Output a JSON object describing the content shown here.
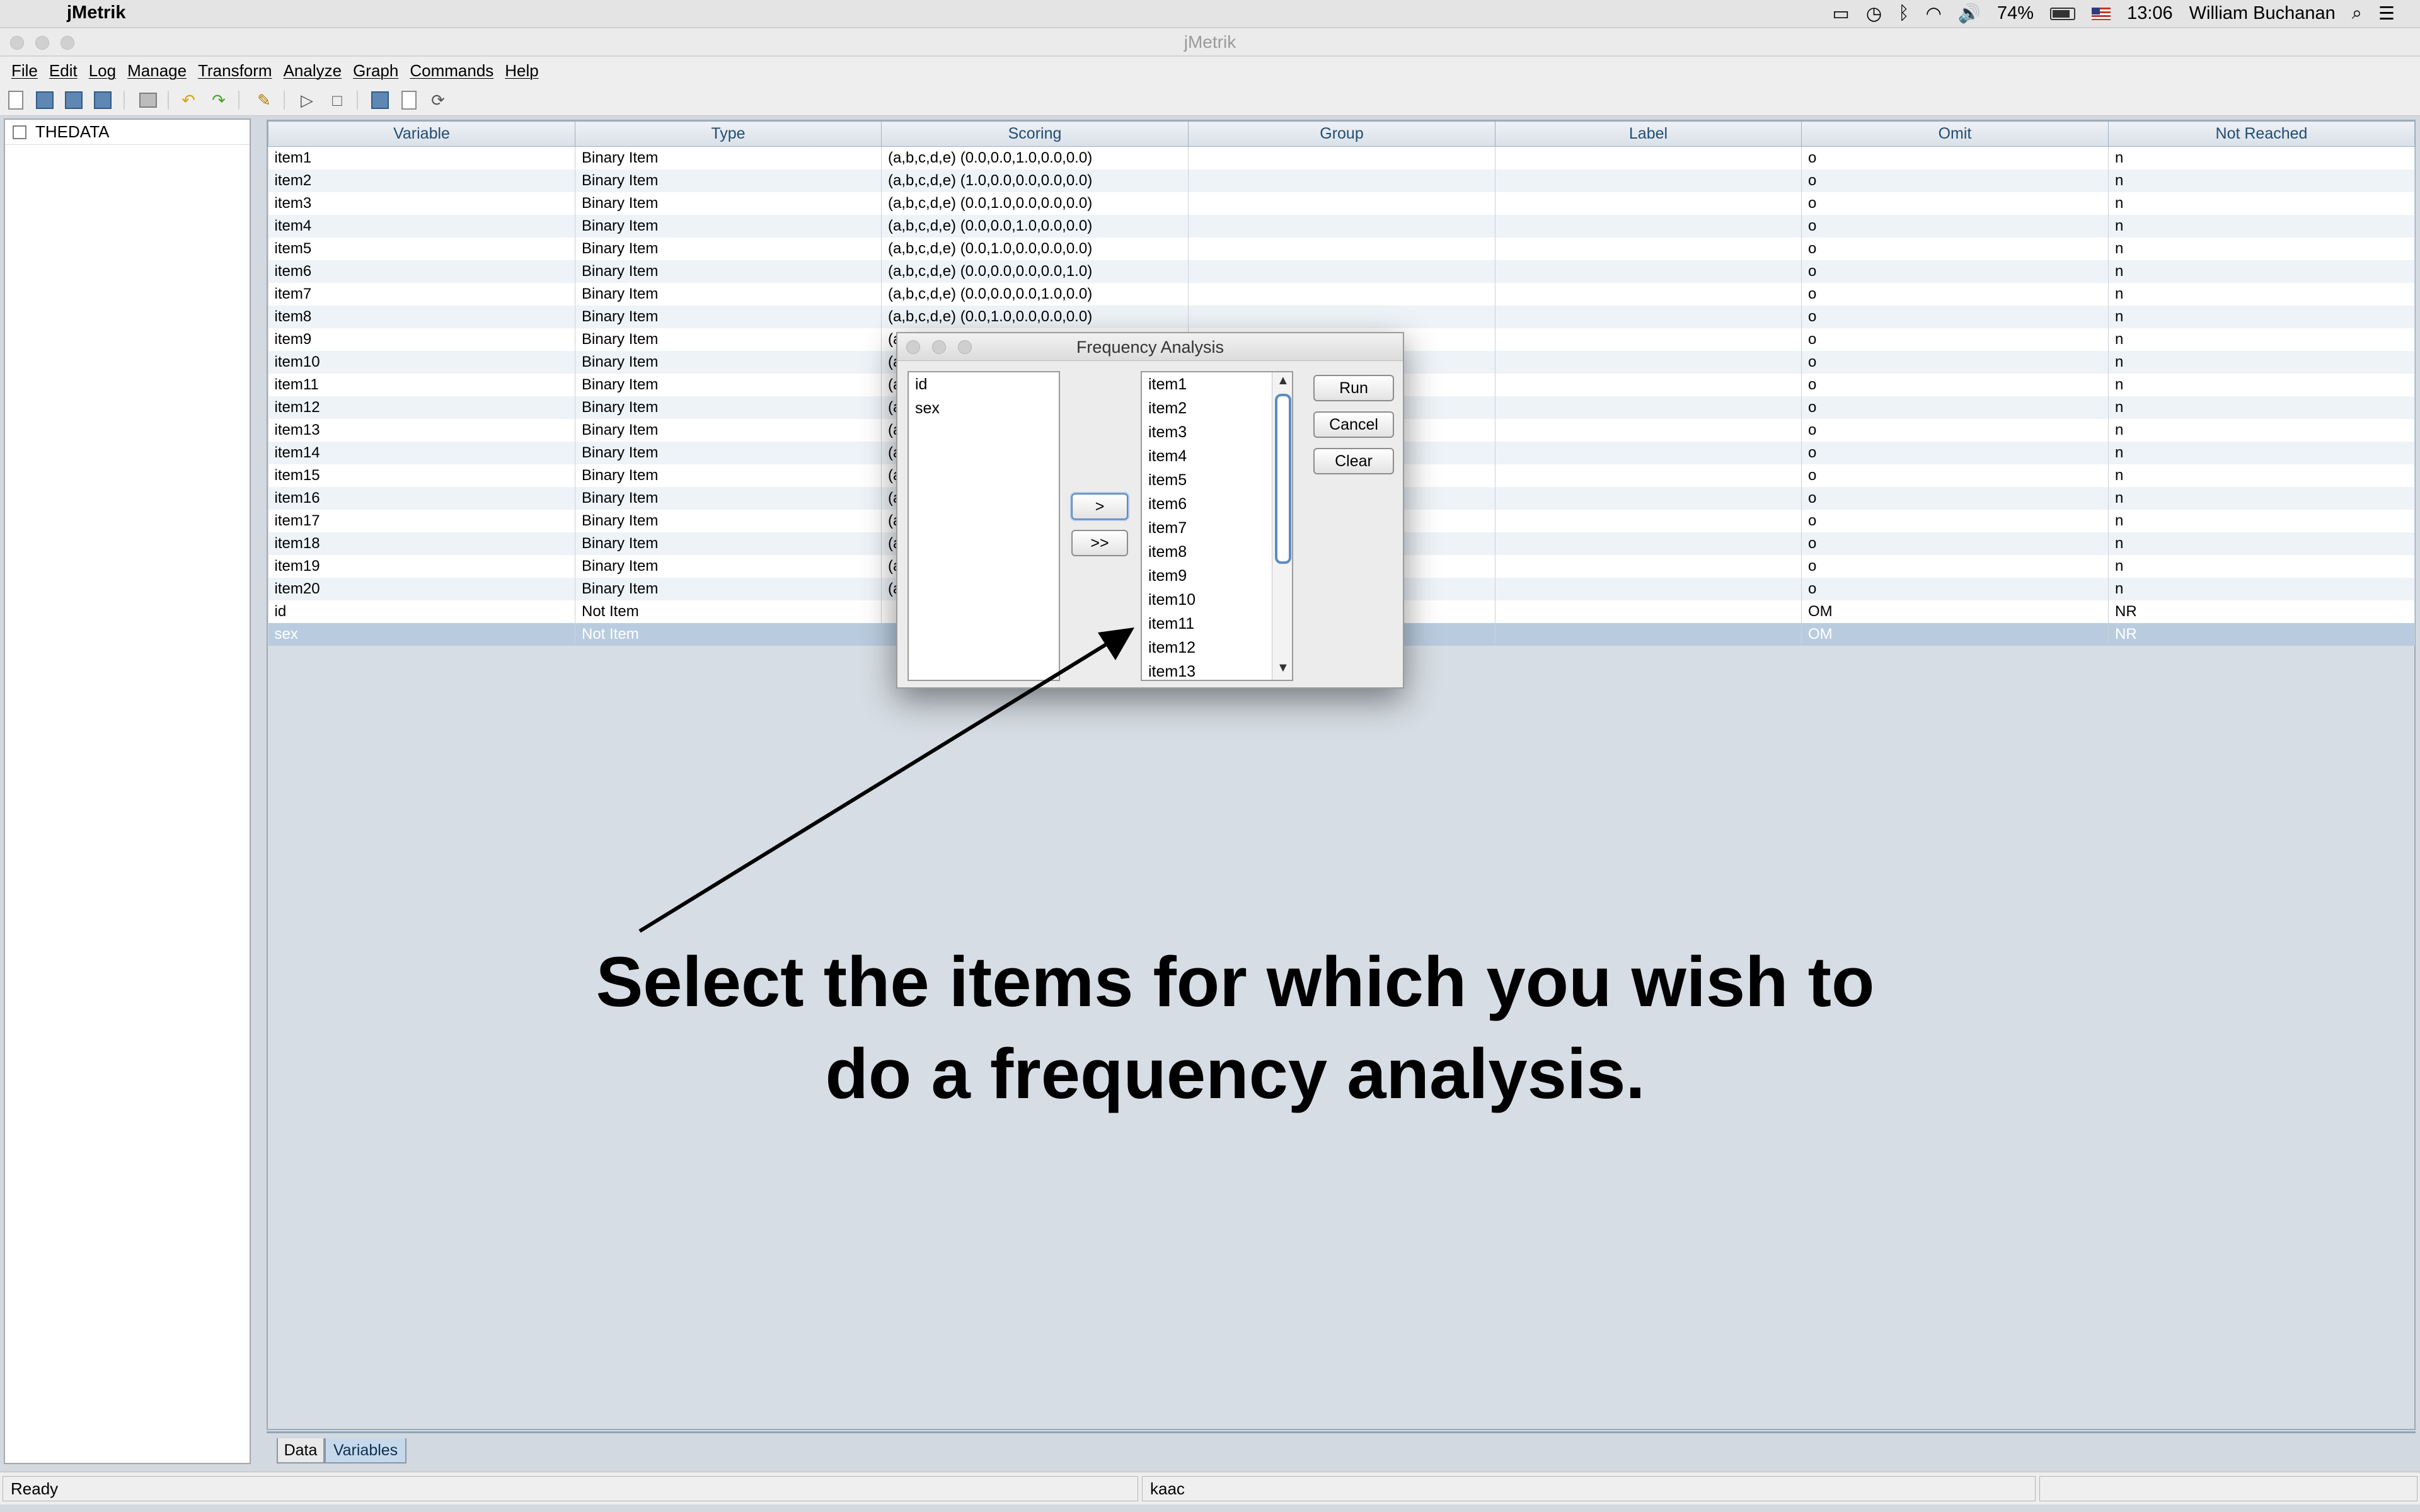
{
  "menubar": {
    "app_name": "jMetrik",
    "battery": "74%",
    "time": "13:06",
    "user": "William Buchanan"
  },
  "window": {
    "title": "jMetrik"
  },
  "app_menu": [
    "File",
    "Edit",
    "Log",
    "Manage",
    "Transform",
    "Analyze",
    "Graph",
    "Commands",
    "Help"
  ],
  "left_panel": {
    "root_label": "THEDATA"
  },
  "table": {
    "headers": [
      "Variable",
      "Type",
      "Scoring",
      "Group",
      "Label",
      "Omit",
      "Not Reached"
    ],
    "rows": [
      [
        "item1",
        "Binary Item",
        "(a,b,c,d,e) (0.0,0.0,1.0,0.0,0.0)",
        "",
        "",
        "o",
        "n"
      ],
      [
        "item2",
        "Binary Item",
        "(a,b,c,d,e) (1.0,0.0,0.0,0.0,0.0)",
        "",
        "",
        "o",
        "n"
      ],
      [
        "item3",
        "Binary Item",
        "(a,b,c,d,e) (0.0,1.0,0.0,0.0,0.0)",
        "",
        "",
        "o",
        "n"
      ],
      [
        "item4",
        "Binary Item",
        "(a,b,c,d,e) (0.0,0.0,1.0,0.0,0.0)",
        "",
        "",
        "o",
        "n"
      ],
      [
        "item5",
        "Binary Item",
        "(a,b,c,d,e) (0.0,1.0,0.0,0.0,0.0)",
        "",
        "",
        "o",
        "n"
      ],
      [
        "item6",
        "Binary Item",
        "(a,b,c,d,e) (0.0,0.0,0.0,0.0,1.0)",
        "",
        "",
        "o",
        "n"
      ],
      [
        "item7",
        "Binary Item",
        "(a,b,c,d,e) (0.0,0.0,0.0,1.0,0.0)",
        "",
        "",
        "o",
        "n"
      ],
      [
        "item8",
        "Binary Item",
        "(a,b,c,d,e) (0.0,1.0,0.0,0.0,0.0)",
        "",
        "",
        "o",
        "n"
      ],
      [
        "item9",
        "Binary Item",
        "(a",
        "",
        "",
        "o",
        "n"
      ],
      [
        "item10",
        "Binary Item",
        "(a",
        "",
        "",
        "o",
        "n"
      ],
      [
        "item11",
        "Binary Item",
        "(a",
        "",
        "",
        "o",
        "n"
      ],
      [
        "item12",
        "Binary Item",
        "(a",
        "",
        "",
        "o",
        "n"
      ],
      [
        "item13",
        "Binary Item",
        "(a",
        "",
        "",
        "o",
        "n"
      ],
      [
        "item14",
        "Binary Item",
        "(a",
        "",
        "",
        "o",
        "n"
      ],
      [
        "item15",
        "Binary Item",
        "(a",
        "",
        "",
        "o",
        "n"
      ],
      [
        "item16",
        "Binary Item",
        "(a",
        "",
        "",
        "o",
        "n"
      ],
      [
        "item17",
        "Binary Item",
        "(a",
        "",
        "",
        "o",
        "n"
      ],
      [
        "item18",
        "Binary Item",
        "(a",
        "",
        "",
        "o",
        "n"
      ],
      [
        "item19",
        "Binary Item",
        "(a",
        "",
        "",
        "o",
        "n"
      ],
      [
        "item20",
        "Binary Item",
        "(a",
        "",
        "",
        "o",
        "n"
      ],
      [
        "id",
        "Not Item",
        "",
        "",
        "",
        "OM",
        "NR"
      ],
      [
        "sex",
        "Not Item",
        "",
        "",
        "",
        "OM",
        "NR"
      ]
    ],
    "selected_row": "sex"
  },
  "tabs": [
    "Data",
    "Variables"
  ],
  "active_tab": "Variables",
  "status": {
    "left": "Ready",
    "middle": "kaac",
    "right": ""
  },
  "dialog": {
    "title": "Frequency Analysis",
    "source_list": [
      "id",
      "sex"
    ],
    "target_list": [
      "item1",
      "item2",
      "item3",
      "item4",
      "item5",
      "item6",
      "item7",
      "item8",
      "item9",
      "item10",
      "item11",
      "item12",
      "item13"
    ],
    "move_one_label": ">",
    "move_all_label": ">>",
    "run_label": "Run",
    "cancel_label": "Cancel",
    "clear_label": "Clear"
  },
  "annotation": {
    "line1": "Select the items for which you wish to",
    "line2": "do a frequency analysis."
  },
  "colors": {
    "selected_row": "#b9ccdf",
    "header_text": "#234d72",
    "focus_ring": "#5b86c0"
  }
}
